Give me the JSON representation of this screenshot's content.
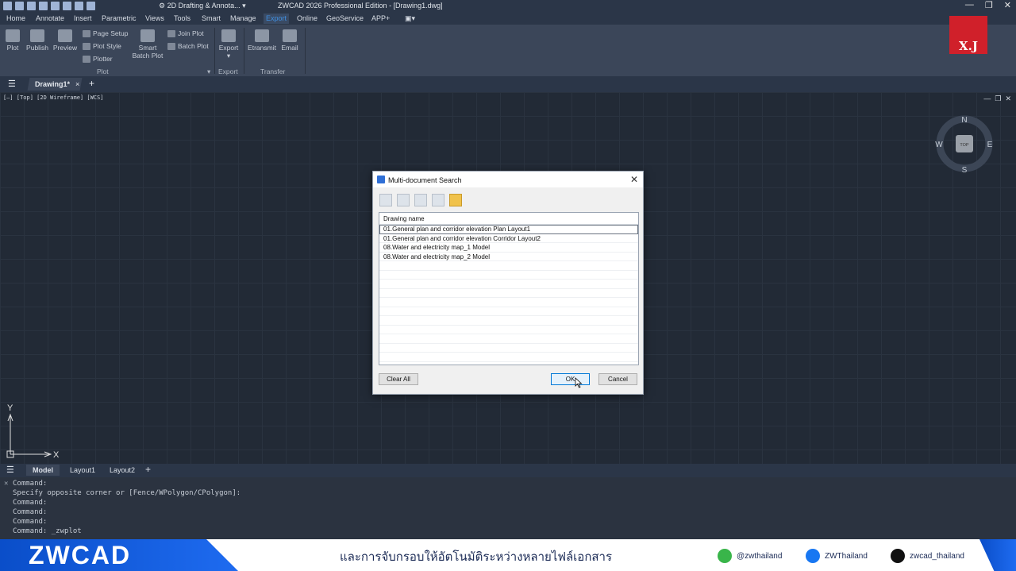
{
  "titlebar": {
    "workspace": "2D Drafting & Annota...",
    "title": "ZWCAD 2026 Professional Edition - [Drawing1.dwg]",
    "window_controls": [
      "—",
      "❐",
      "✕"
    ]
  },
  "menu": {
    "tabs": [
      "Home",
      "Annotate",
      "Insert",
      "Parametric",
      "Views",
      "Tools",
      "Smart",
      "Manage",
      "Export",
      "Online",
      "GeoService",
      "APP+"
    ],
    "active": "Export"
  },
  "ribbon": {
    "plot": "Plot",
    "publish": "Publish",
    "preview": "Preview",
    "page_setup": "Page Setup",
    "plot_style": "Plot Style",
    "plotter": "Plotter",
    "smart_batch_plot_1": "Smart",
    "smart_batch_plot_2": "Batch Plot",
    "join_plot": "Join Plot",
    "batch_plot": "Batch Plot",
    "export": "Export",
    "etransmit": "Etransmit",
    "email": "Email",
    "group_plot": "Plot",
    "group_export": "Export",
    "group_transfer": "Transfer"
  },
  "logo_text": "X.J",
  "doc_tab": {
    "name": "Drawing1*",
    "close": "×",
    "add": "+"
  },
  "viewport_label": "[—] [Top] [2D Wireframe] [WCS]",
  "compass": {
    "n": "N",
    "s": "S",
    "e": "E",
    "w": "W",
    "center": "TOP"
  },
  "ucs": {
    "x": "X",
    "y": "Y"
  },
  "layout_tabs": {
    "model": "Model",
    "layout1": "Layout1",
    "layout2": "Layout2",
    "add": "+"
  },
  "command_lines": [
    "Command:",
    "Specify opposite corner or [Fence/WPolygon/CPolygon]:",
    "Command:",
    "Command:",
    "Command:",
    "Command: _zwplot"
  ],
  "dialog": {
    "title": "Multi-document Search",
    "close": "✕",
    "column_header": "Drawing name",
    "rows": [
      "01.General plan and corridor elevation Plan Layout1",
      "01.General plan and corridor elevation Corridor Layout2",
      "08.Water and electricity map_1 Model",
      "08.Water and electricity map_2 Model"
    ],
    "clear_all": "Clear All",
    "ok": "OK",
    "cancel": "Cancel"
  },
  "footer": {
    "brand": "ZWCAD",
    "tagline": "และการจับกรอบให้อัตโนมัติระหว่างหลายไฟล์เอกสาร",
    "line": "@zwthailand",
    "facebook": "ZWThailand",
    "tiktok": "zwcad_thailand"
  },
  "colors": {
    "accent": "#3f8fe0",
    "brand_blue": "#1e6bf0",
    "logo_red": "#d0202a"
  }
}
